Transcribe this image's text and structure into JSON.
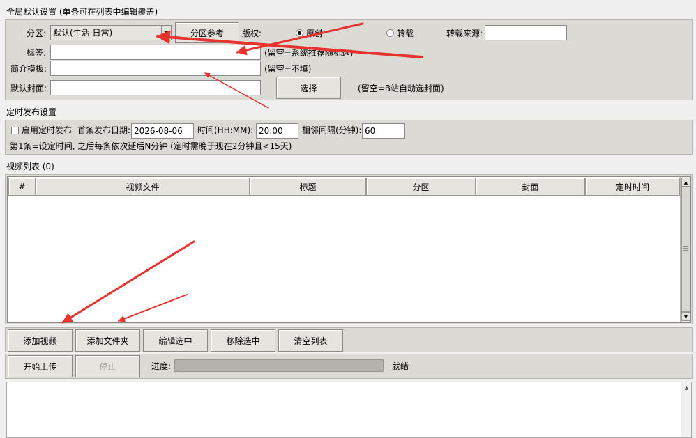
{
  "global": {
    "title": "全局默认设置 (单条可在列表中编辑覆盖)",
    "category_label": "分区:",
    "category_value": "默认(生活·日常)",
    "category_ref_button": "分区参考",
    "copyright_label": "版权:",
    "copyright_original": "原创",
    "copyright_repost": "转载",
    "repost_source_label": "转载来源:",
    "repost_source_value": "",
    "tags_label": "标签:",
    "tags_value": "",
    "tags_hint": "(留空=系统推荐随机选)",
    "desc_label": "简介模板:",
    "desc_value": "",
    "desc_hint": "(留空=不填)",
    "cover_label": "默认封面:",
    "cover_value": "",
    "cover_button": "选择",
    "cover_hint": "(留空=B站自动选封面)"
  },
  "schedule": {
    "title": "定时发布设置",
    "enable_label": "启用定时发布",
    "first_date_label": "首条发布日期:",
    "first_date_value": "2026-08-06",
    "time_label": "时间(HH:MM):",
    "time_value": "20:00",
    "interval_label": "相邻间隔(分钟):",
    "interval_value": "60",
    "note": "第1条=设定时间, 之后每条依次延后N分钟 (定时需晚于现在2分钟且<15天)"
  },
  "video_list": {
    "title": "视频列表 (0)",
    "columns": [
      "#",
      "视频文件",
      "标题",
      "分区",
      "封面",
      "定时时间"
    ]
  },
  "list_buttons": {
    "add_video": "添加视频",
    "add_folder": "添加文件夹",
    "edit_selected": "编辑选中",
    "remove_selected": "移除选中",
    "clear_list": "清空列表"
  },
  "upload": {
    "start_button": "开始上传",
    "stop_button": "停止",
    "progress_label": "进度:",
    "progress_fraction": 0,
    "status": "就绪"
  },
  "colors": {
    "annotation_arrow": "#e8322d",
    "panel_bg": "#dcdad5",
    "window_bg": "#f0f0f0"
  }
}
